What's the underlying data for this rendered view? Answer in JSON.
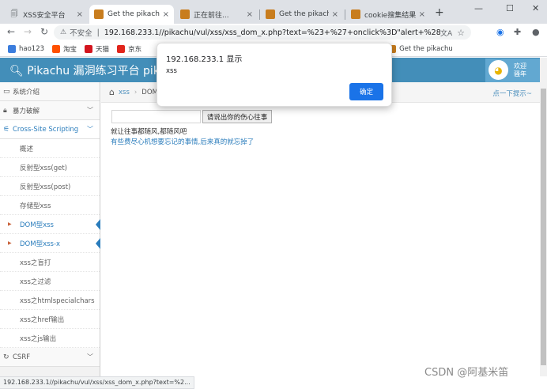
{
  "browser": {
    "tabs": [
      {
        "title": "XSS安全平台",
        "active": false
      },
      {
        "title": "Get the pikachu",
        "active": true
      },
      {
        "title": "正在前往...",
        "active": false
      },
      {
        "title": "Get the pikachu",
        "active": false
      },
      {
        "title": "cookie搜集结果",
        "active": false
      }
    ],
    "close_glyph": "×",
    "new_tab_glyph": "+",
    "window_controls": {
      "minimize": "—",
      "maximize": "☐",
      "close": "✕"
    },
    "nav": {
      "back": "←",
      "forward": "→",
      "reload": "↻"
    },
    "address": {
      "security_label": "不安全",
      "url": "192.168.233.1//pikachu/vul/xss/xss_dom_x.php?text=%23+%27+onclick%3D\"alert+%28%27xss..."
    },
    "bookmarks": [
      {
        "label": "hao123",
        "color": "#3b7ddd"
      },
      {
        "label": "淘宝",
        "color": "#ff5000"
      },
      {
        "label": "天猫",
        "color": "#d3151e"
      },
      {
        "label": "京东",
        "color": "#e1251b"
      },
      {
        "label": "Get the pikachu",
        "color": "#c87d1e"
      }
    ]
  },
  "page": {
    "brand": "Pikachu 漏洞练习平台 pika",
    "welcome": [
      "欢迎",
      "骚年"
    ],
    "sidebar": {
      "top_items": [
        {
          "label": "系统介绍",
          "icon": "desktop-icon"
        },
        {
          "label": "暴力破解",
          "icon": "lock-icon"
        }
      ],
      "open_section": "Cross-Site Scripting",
      "sub_items": [
        {
          "label": "概述",
          "active": false
        },
        {
          "label": "反射型xss(get)",
          "active": false
        },
        {
          "label": "反射型xss(post)",
          "active": false
        },
        {
          "label": "存储型xss",
          "active": false
        },
        {
          "label": "DOM型xss",
          "active": true
        },
        {
          "label": "DOM型xss-x",
          "active": true
        },
        {
          "label": "xss之盲打",
          "active": false
        },
        {
          "label": "xss之过滤",
          "active": false
        },
        {
          "label": "xss之htmlspecialchars",
          "active": false
        },
        {
          "label": "xss之href输出",
          "active": false
        },
        {
          "label": "xss之js输出",
          "active": false
        }
      ],
      "bottom_item": "CSRF"
    },
    "breadcrumb": {
      "first": "xss",
      "second": "DOM"
    },
    "tips": "点一下提示~",
    "form": {
      "input_value": "",
      "button_label": "请说出你的伤心往事"
    },
    "line1": "就让往事都随风,都随风吧",
    "line2": "有些费尽心机想要忘记的事情,后来真的就忘掉了"
  },
  "dialog": {
    "title": "192.168.233.1 显示",
    "message": "xss",
    "ok_label": "确定"
  },
  "status_url": "192.168.233.1//pikachu/vul/xss/xss_dom_x.php?text=%2...",
  "watermark": "CSDN @阿基米笛"
}
